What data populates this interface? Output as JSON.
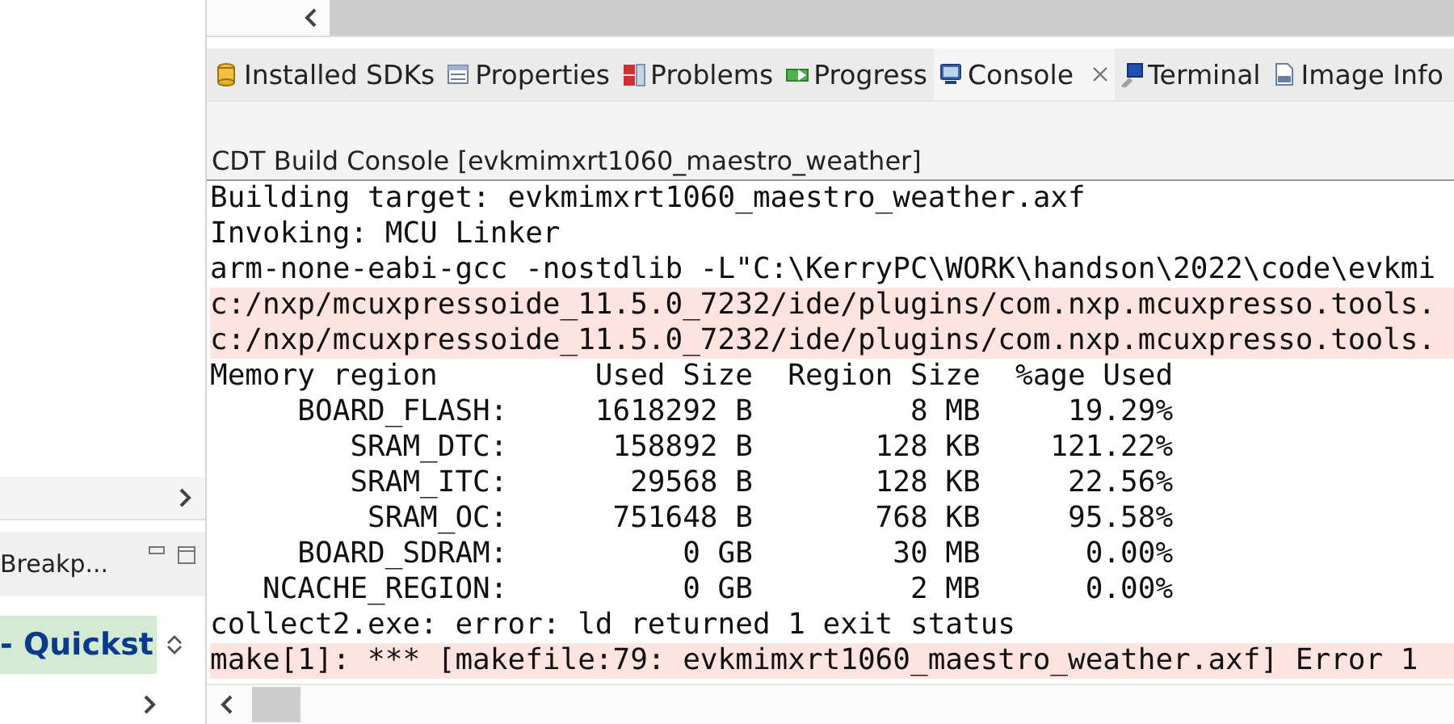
{
  "left_panel": {
    "view_tab": "Breakp...",
    "outline_item": "- Quickst"
  },
  "tabs": [
    {
      "label": "Installed SDKs",
      "kind": "sdk",
      "selected": false
    },
    {
      "label": "Properties",
      "kind": "properties",
      "selected": false
    },
    {
      "label": "Problems",
      "kind": "problems",
      "selected": false
    },
    {
      "label": "Progress",
      "kind": "progress",
      "selected": false
    },
    {
      "label": "Console",
      "kind": "console",
      "selected": true
    },
    {
      "label": "Terminal",
      "kind": "terminal",
      "selected": false
    },
    {
      "label": "Image Info",
      "kind": "image",
      "selected": false
    }
  ],
  "console": {
    "title": "CDT Build Console [evkmimxrt1060_maestro_weather]",
    "lines": [
      {
        "text": "Building target: evkmimxrt1060_maestro_weather.axf",
        "kind": "normal"
      },
      {
        "text": "Invoking: MCU Linker",
        "kind": "normal"
      },
      {
        "text": "arm-none-eabi-gcc -nostdlib -L\"C:\\KerryPC\\WORK\\handson\\2022\\code\\evkmi",
        "kind": "normal"
      },
      {
        "text": "c:/nxp/mcuxpressoide_11.5.0_7232/ide/plugins/com.nxp.mcuxpresso.tools.",
        "kind": "error"
      },
      {
        "text": "c:/nxp/mcuxpressoide_11.5.0_7232/ide/plugins/com.nxp.mcuxpresso.tools.",
        "kind": "error"
      },
      {
        "text": "Memory region         Used Size  Region Size  %age Used",
        "kind": "normal"
      },
      {
        "text": "     BOARD_FLASH:     1618292 B         8 MB     19.29%",
        "kind": "normal"
      },
      {
        "text": "        SRAM_DTC:      158892 B       128 KB    121.22%",
        "kind": "normal"
      },
      {
        "text": "        SRAM_ITC:       29568 B       128 KB     22.56%",
        "kind": "normal"
      },
      {
        "text": "         SRAM_OC:      751648 B       768 KB     95.58%",
        "kind": "normal"
      },
      {
        "text": "     BOARD_SDRAM:          0 GB        30 MB      0.00%",
        "kind": "normal"
      },
      {
        "text": "   NCACHE_REGION:          0 GB         2 MB      0.00%",
        "kind": "normal"
      },
      {
        "text": "collect2.exe: error: ld returned 1 exit status",
        "kind": "normal"
      },
      {
        "text": "make[1]: *** [makefile:79: evkmimxrt1060_maestro_weather.axf] Error 1",
        "kind": "error"
      }
    ]
  }
}
